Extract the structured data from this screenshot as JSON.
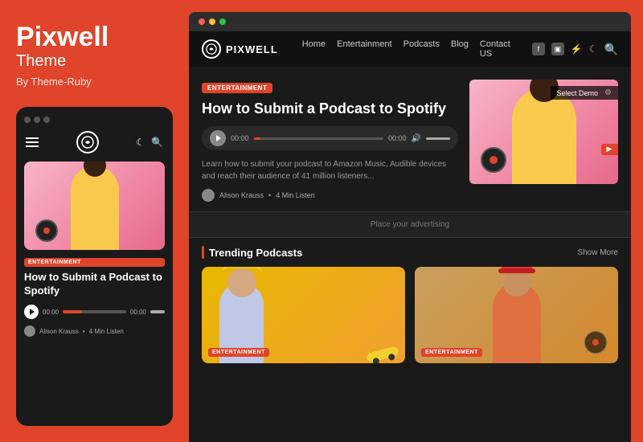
{
  "left": {
    "brand_title": "Pixwell",
    "brand_subtitle": "Theme",
    "brand_by": "By Theme-Ruby",
    "mobile": {
      "badge": "ENTERTAINMENT",
      "article_title": "How to Submit a Podcast to Spotify",
      "author_name": "Alison Krauss",
      "read_time": "4 Min Listen",
      "player_time_elapsed": "00:00",
      "player_time_total": "00:00"
    }
  },
  "browser": {
    "brand_name": "PIXWELL",
    "nav_links": [
      "Home",
      "Entertainment",
      "Podcasts",
      "Blog",
      "Contact US"
    ],
    "hero": {
      "badge": "ENTERTAINMENT",
      "title": "How to Submit a Podcast to Spotify",
      "desc": "Learn how to submit your podcast to Amazon Music, Audible devices and reach their audience of 41 million listeners...",
      "time_elapsed": "00:00",
      "time_total": "00:00",
      "author_name": "Alison Krauss",
      "read_time": "4 Min Listen",
      "select_demo_label": "Select Demo"
    },
    "ad_banner_text": "Place your advertising",
    "trending": {
      "title": "Trending Podcasts",
      "show_more": "Show More",
      "cards": [
        {
          "badge": "ENTERTAINMENT"
        },
        {
          "badge": "ENTERTAINMENT"
        }
      ]
    }
  }
}
